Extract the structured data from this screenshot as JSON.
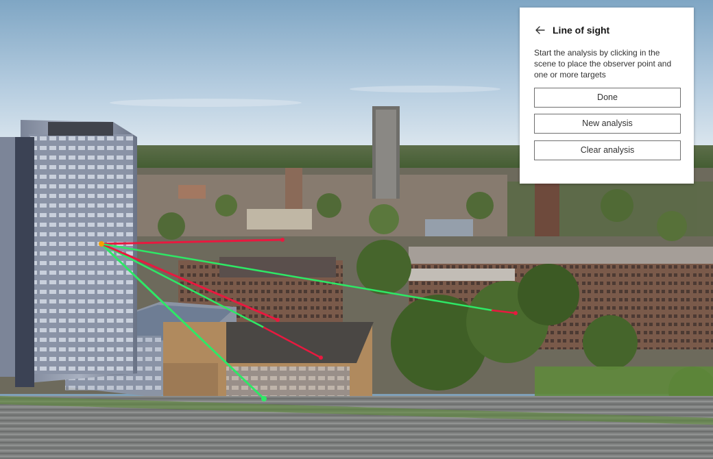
{
  "panel": {
    "title": "Line of sight",
    "description": "Start the analysis by clicking in the scene to place the observer point and one or more targets",
    "buttons": {
      "done": "Done",
      "new_analysis": "New analysis",
      "clear_analysis": "Clear analysis"
    }
  },
  "icons": {
    "back": "arrow-left-icon"
  },
  "colors": {
    "visible_line": "#2ee866",
    "obstructed_line": "#e8193f",
    "observer_point": "#f5a000"
  }
}
